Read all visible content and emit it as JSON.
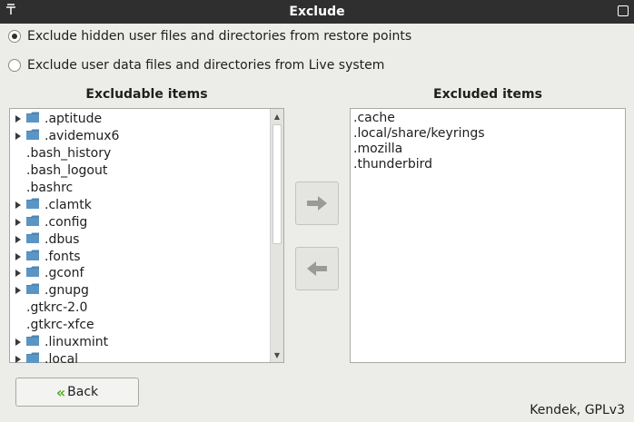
{
  "window": {
    "title": "Exclude"
  },
  "options": [
    {
      "label": "Exclude hidden user files and directories from restore points",
      "checked": true
    },
    {
      "label": "Exclude user data files and directories from Live system",
      "checked": false
    }
  ],
  "left_panel": {
    "header": "Excludable items",
    "items": [
      {
        "label": ".aptitude",
        "folder": true
      },
      {
        "label": ".avidemux6",
        "folder": true
      },
      {
        "label": ".bash_history",
        "folder": false
      },
      {
        "label": ".bash_logout",
        "folder": false
      },
      {
        "label": ".bashrc",
        "folder": false
      },
      {
        "label": ".clamtk",
        "folder": true
      },
      {
        "label": ".config",
        "folder": true
      },
      {
        "label": ".dbus",
        "folder": true
      },
      {
        "label": ".fonts",
        "folder": true
      },
      {
        "label": ".gconf",
        "folder": true
      },
      {
        "label": ".gnupg",
        "folder": true
      },
      {
        "label": ".gtkrc-2.0",
        "folder": false
      },
      {
        "label": ".gtkrc-xfce",
        "folder": false
      },
      {
        "label": ".linuxmint",
        "folder": true
      },
      {
        "label": ".local",
        "folder": true
      }
    ]
  },
  "right_panel": {
    "header": "Excluded items",
    "items": [
      ".cache",
      ".local/share/keyrings",
      ".mozilla",
      ".thunderbird"
    ]
  },
  "buttons": {
    "back": "Back"
  },
  "footer": "Kendek, GPLv3",
  "colors": {
    "titlebar": "#2f2f2f",
    "folder": "#4e86b5",
    "back_chevron": "#4caf1f",
    "arrow": "#9a9a98"
  }
}
